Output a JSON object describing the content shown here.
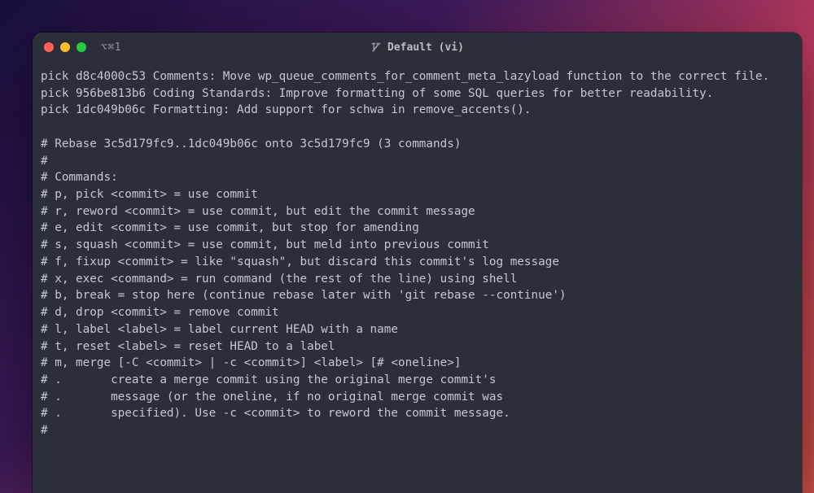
{
  "titlebar": {
    "tab_hint": "⌥⌘1",
    "title": "Default (vi)"
  },
  "editor": {
    "picks": [
      "pick d8c4000c53 Comments: Move wp_queue_comments_for_comment_meta_lazyload function to the correct file.",
      "pick 956be813b6 Coding Standards: Improve formatting of some SQL queries for better readability.",
      "pick 1dc049b06c Formatting: Add support for schwa in remove_accents()."
    ],
    "rebase_header": "# Rebase 3c5d179fc9..1dc049b06c onto 3c5d179fc9 (3 commands)",
    "commands_title": "# Commands:",
    "commands": [
      "# p, pick <commit> = use commit",
      "# r, reword <commit> = use commit, but edit the commit message",
      "# e, edit <commit> = use commit, but stop for amending",
      "# s, squash <commit> = use commit, but meld into previous commit",
      "# f, fixup <commit> = like \"squash\", but discard this commit's log message",
      "# x, exec <command> = run command (the rest of the line) using shell",
      "# b, break = stop here (continue rebase later with 'git rebase --continue')",
      "# d, drop <commit> = remove commit",
      "# l, label <label> = label current HEAD with a name",
      "# t, reset <label> = reset HEAD to a label",
      "# m, merge [-C <commit> | -c <commit>] <label> [# <oneline>]",
      "# .       create a merge commit using the original merge commit's",
      "# .       message (or the oneline, if no original merge commit was",
      "# .       specified). Use -c <commit> to reword the commit message.",
      "#"
    ]
  }
}
